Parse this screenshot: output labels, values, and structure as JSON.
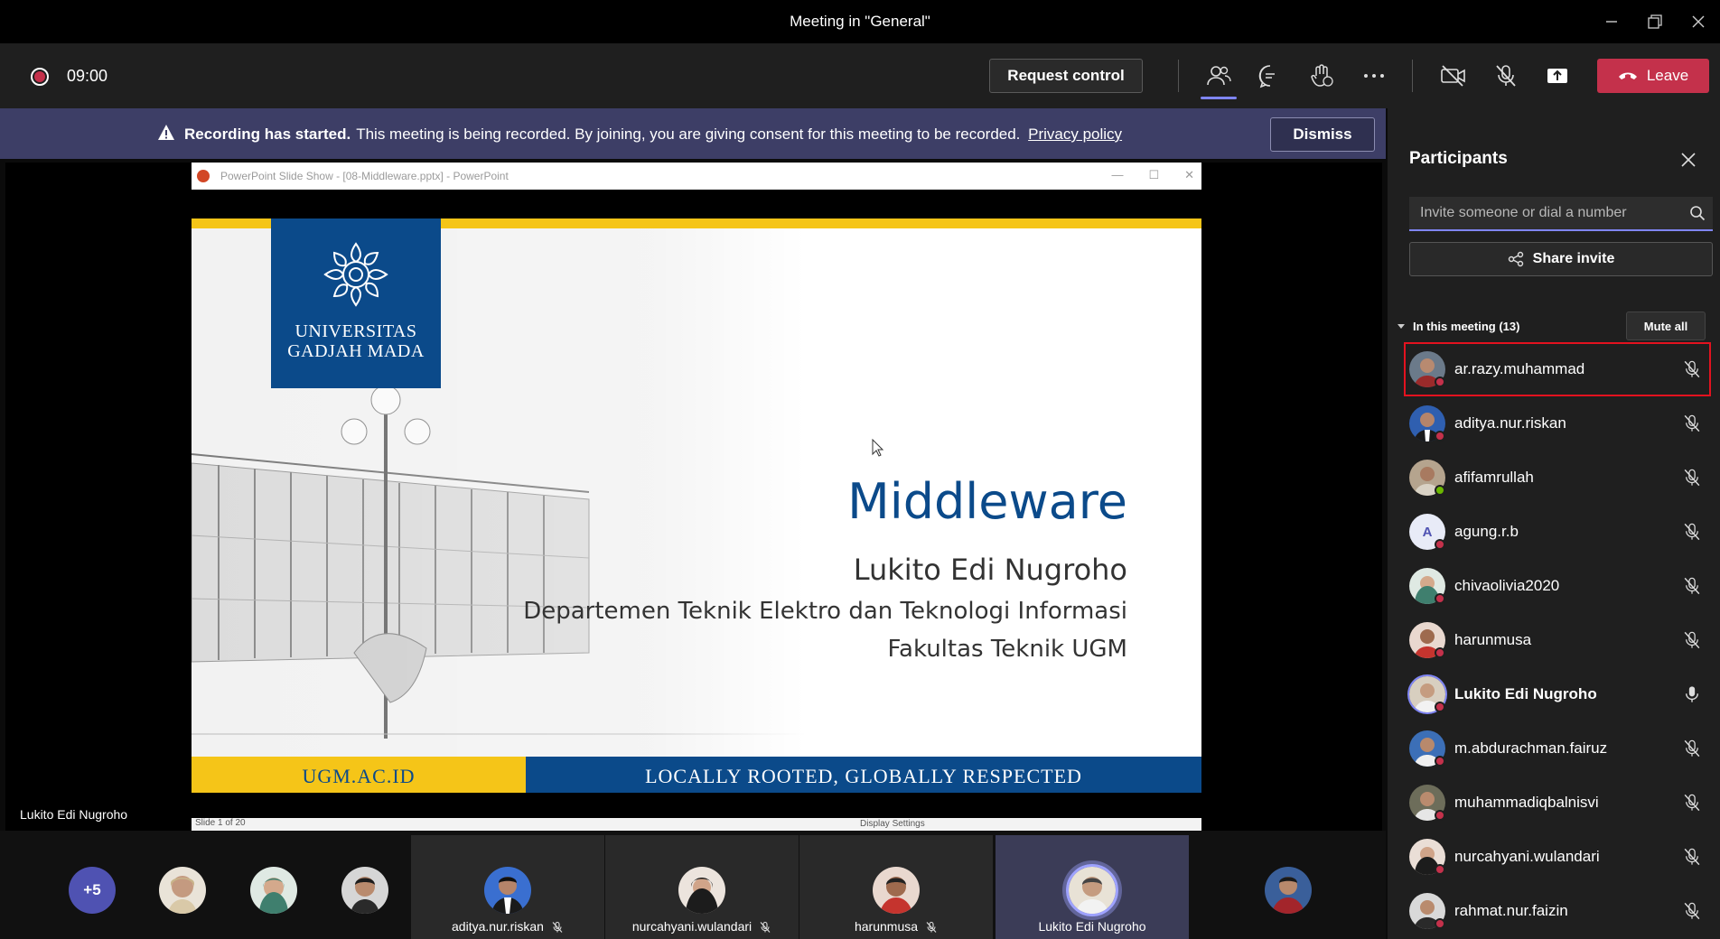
{
  "window": {
    "title": "Meeting in \"General\""
  },
  "toolbar": {
    "timer": "09:00",
    "request_control": "Request control",
    "leave": "Leave",
    "icons": [
      "participants-icon",
      "chat-icon",
      "reactions-icon",
      "more-icon",
      "camera-off-icon",
      "mic-off-icon",
      "share-tray-icon"
    ]
  },
  "banner": {
    "bold": "Recording has started.",
    "text": "This meeting is being recorded. By joining, you are giving consent for this meeting to be recorded.",
    "link": "Privacy policy",
    "dismiss": "Dismiss"
  },
  "ppt": {
    "window_title": "PowerPoint Slide Show - [08-Middleware.pptx] - PowerPoint",
    "logo_line1": "UNIVERSITAS",
    "logo_line2": "GADJAH MADA",
    "title": "Middleware",
    "author": "Lukito Edi Nugroho",
    "dept": "Departemen Teknik Elektro dan Teknologi Informasi",
    "faculty": "Fakultas Teknik UGM",
    "footer_left": "UGM.AC.ID",
    "footer_right": "LOCALLY ROOTED, GLOBALLY RESPECTED",
    "status_left": "Slide 1 of 20",
    "status_display": "Display Settings"
  },
  "presenter_label": "Lukito Edi Nugroho",
  "strip": {
    "more_count": "+5",
    "tiles": [
      {
        "name": "aditya.nur.riskan",
        "muted": true
      },
      {
        "name": "nurcahyani.wulandari",
        "muted": true
      },
      {
        "name": "harunmusa",
        "muted": true
      },
      {
        "name": "Lukito Edi Nugroho",
        "muted": false
      }
    ]
  },
  "panel": {
    "title": "Participants",
    "invite_placeholder": "Invite someone or dial a number",
    "share_invite": "Share invite",
    "section": "In this meeting (13)",
    "mute_all": "Mute all",
    "participants": [
      {
        "name": "ar.razy.muhammad",
        "status": "busy",
        "muted": true,
        "avatar_color": "#8a2b2b"
      },
      {
        "name": "aditya.nur.riskan",
        "status": "busy",
        "muted": true,
        "avatar_color": "#2f5fb0"
      },
      {
        "name": "afifamrullah",
        "status": "available",
        "muted": true,
        "avatar_color": "#b5a48e"
      },
      {
        "name": "agung.r.b",
        "status": "busy",
        "muted": true,
        "initial": "A"
      },
      {
        "name": "chivaolivia2020",
        "status": "busy",
        "muted": true,
        "avatar_color": "#c9d6c8"
      },
      {
        "name": "harunmusa",
        "status": "busy",
        "muted": true,
        "avatar_color": "#b0473a"
      },
      {
        "name": "Lukito Edi Nugroho",
        "status": "busy",
        "muted": false,
        "avatar_color": "#d8cfc0"
      },
      {
        "name": "m.abdurachman.fairuz",
        "status": "busy",
        "muted": true,
        "avatar_color": "#3c6fb7"
      },
      {
        "name": "muhammadiqbalnisvi",
        "status": "busy",
        "muted": true,
        "avatar_color": "#6d6d5a"
      },
      {
        "name": "nurcahyani.wulandari",
        "status": "busy",
        "muted": true,
        "avatar_color": "#eaded6"
      },
      {
        "name": "rahmat.nur.faizin",
        "status": "busy",
        "muted": true,
        "avatar_color": "#d9d9d9"
      }
    ]
  },
  "colors": {
    "accent": "#7f85f5",
    "leave": "#c4314b",
    "banner": "#3d3e66",
    "ugm_blue": "#0b4a8a",
    "ugm_yellow": "#f5c518"
  }
}
